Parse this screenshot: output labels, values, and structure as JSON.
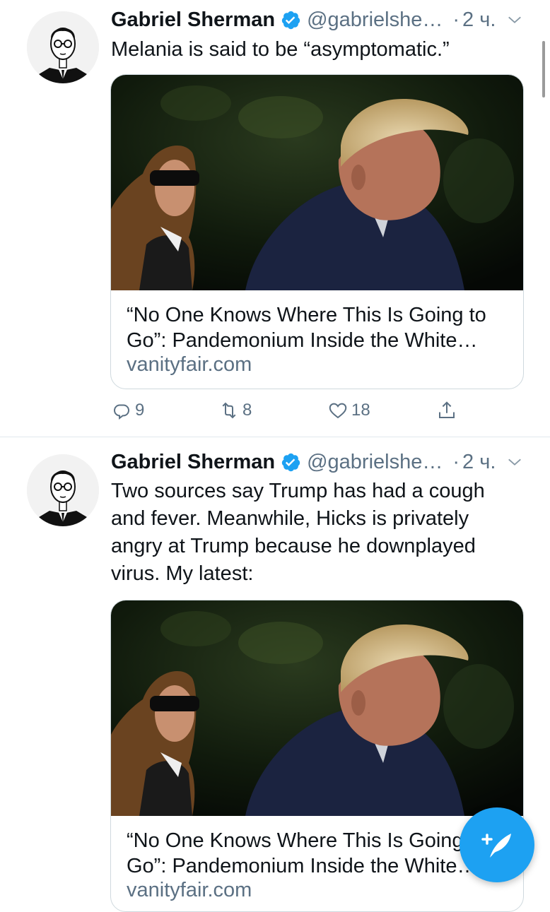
{
  "tweets": [
    {
      "author_name": "Gabriel Sherman",
      "handle": "@gabrielshe…",
      "separator": "·",
      "time": "2 ч.",
      "text": "Melania is said to be “asymptomatic.”",
      "card": {
        "title": "“No One Knows Where This Is Going to Go”: Pandemonium Inside the White…",
        "domain": "vanityfair.com"
      },
      "actions": {
        "reply_count": "9",
        "retweet_count": "8",
        "like_count": "18"
      }
    },
    {
      "author_name": "Gabriel Sherman",
      "handle": "@gabrielshe…",
      "separator": "·",
      "time": "2 ч.",
      "text": "Two sources say Trump has had a cough and fever. Meanwhile, Hicks is privately angry at Trump because he downplayed virus. My latest:",
      "card": {
        "title": "“No One Knows Where This Is Going to Go”: Pandemonium Inside the White…",
        "domain": "vanityfair.com"
      }
    }
  ],
  "colors": {
    "accent": "#1da1f2",
    "text_primary": "#0f1419",
    "text_secondary": "#5b7083",
    "border": "#cfd9de"
  },
  "icons": {
    "verified": "verified-badge-icon",
    "menu": "chevron-down-icon",
    "reply": "reply-icon",
    "retweet": "retweet-icon",
    "like": "heart-icon",
    "share": "share-icon",
    "compose": "compose-tweet-icon"
  }
}
